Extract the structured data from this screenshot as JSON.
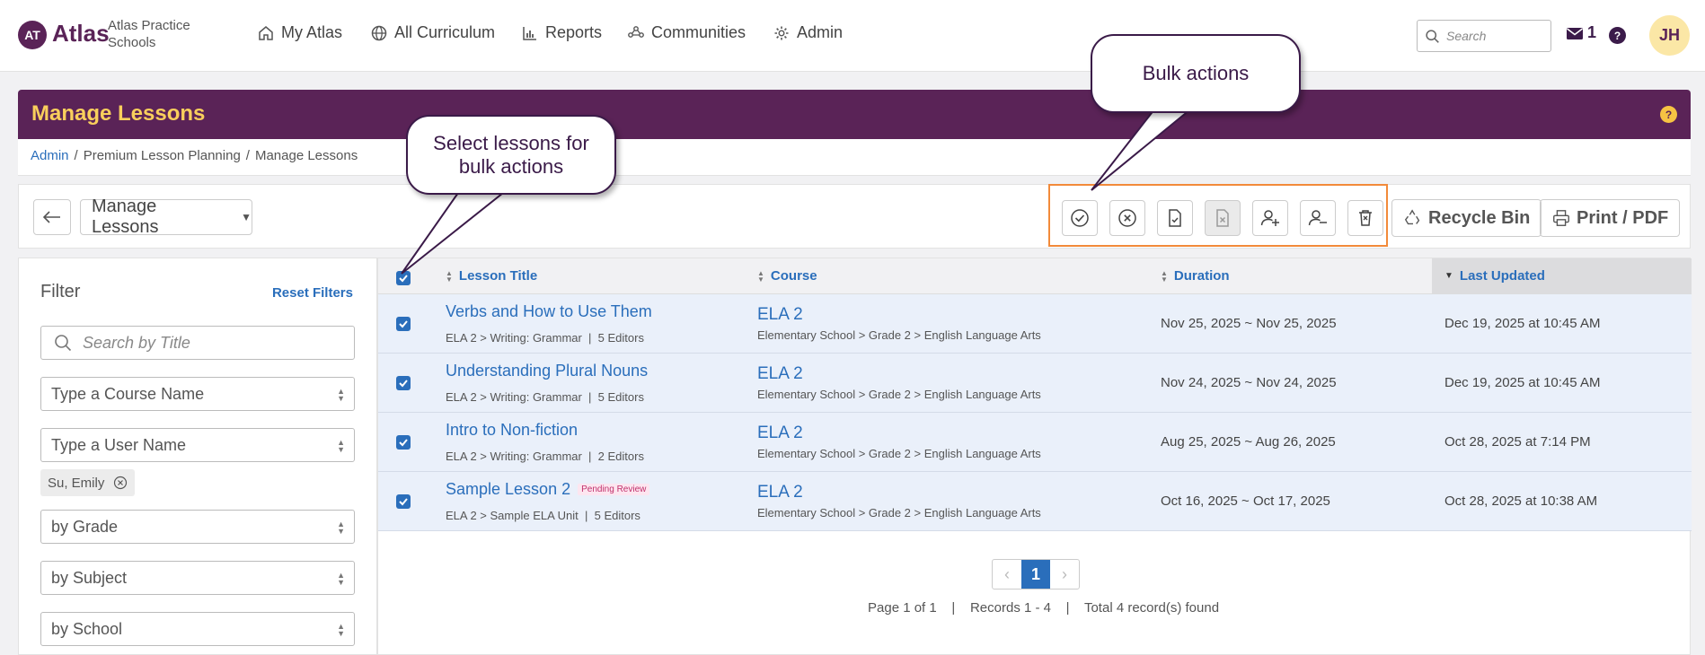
{
  "topnav": {
    "logo_initials": "AT",
    "logo_text": "Atlas",
    "school_name": "Atlas Practice Schools",
    "items": [
      {
        "label": "My Atlas",
        "icon": "home-icon"
      },
      {
        "label": "All Curriculum",
        "icon": "globe-icon"
      },
      {
        "label": "Reports",
        "icon": "bar-chart-icon"
      },
      {
        "label": "Communities",
        "icon": "network-icon"
      },
      {
        "label": "Admin",
        "icon": "gear-icon"
      }
    ],
    "search_placeholder": "Search",
    "mail_count": "1",
    "help": "?",
    "avatar_initials": "JH"
  },
  "banner": {
    "title": "Manage Lessons",
    "help": "?"
  },
  "breadcrumb": {
    "items": [
      "Admin",
      "Premium Lesson Planning",
      "Manage Lessons"
    ],
    "separator": "/"
  },
  "toolbar": {
    "view_select": "Manage Lessons",
    "bulk_actions": [
      {
        "name": "approve",
        "icon": "check-circle-icon"
      },
      {
        "name": "reject",
        "icon": "x-circle-icon"
      },
      {
        "name": "mark-complete",
        "icon": "doc-check-icon"
      },
      {
        "name": "mark-incomplete",
        "icon": "doc-x-icon",
        "disabled": true
      },
      {
        "name": "add-editor",
        "icon": "user-plus-icon"
      },
      {
        "name": "remove-editor",
        "icon": "user-minus-icon"
      },
      {
        "name": "delete",
        "icon": "trash-icon"
      }
    ],
    "recycle_bin": "Recycle Bin",
    "print_pdf": "Print / PDF"
  },
  "filter": {
    "title": "Filter",
    "reset": "Reset Filters",
    "search_placeholder": "Search by Title",
    "course_placeholder": "Type a Course Name",
    "user_placeholder": "Type a User Name",
    "selected_user": "Su, Emily",
    "grade": "by Grade",
    "subject": "by Subject",
    "school": "by School"
  },
  "table": {
    "headers": {
      "title": "Lesson Title",
      "course": "Course",
      "duration": "Duration",
      "updated": "Last Updated"
    },
    "rows": [
      {
        "title": "Verbs and How to Use Them",
        "badge": "",
        "sub": "ELA 2 > Writing: Grammar  |  5 Editors",
        "course": "ELA 2",
        "course_sub": "Elementary School > Grade 2 > English Language Arts",
        "duration": "Nov 25, 2025 ~ Nov 25, 2025",
        "updated": "Dec 19, 2025 at 10:45 AM"
      },
      {
        "title": "Understanding Plural Nouns",
        "badge": "",
        "sub": "ELA 2 > Writing: Grammar  |  5 Editors",
        "course": "ELA 2",
        "course_sub": "Elementary School > Grade 2 > English Language Arts",
        "duration": "Nov 24, 2025 ~ Nov 24, 2025",
        "updated": "Dec 19, 2025 at 10:45 AM"
      },
      {
        "title": "Intro to Non-fiction",
        "badge": "",
        "sub": "ELA 2 > Writing: Grammar  |  2 Editors",
        "course": "ELA 2",
        "course_sub": "Elementary School > Grade 2 > English Language Arts",
        "duration": "Aug 25, 2025 ~ Aug 26, 2025",
        "updated": "Oct 28, 2025 at 7:14 PM"
      },
      {
        "title": "Sample Lesson 2",
        "badge": "Pending Review",
        "sub": "ELA 2 > Sample ELA Unit  |  5 Editors",
        "course": "ELA 2",
        "course_sub": "Elementary School > Grade 2 > English Language Arts",
        "duration": "Oct 16, 2025 ~ Oct 17, 2025",
        "updated": "Oct 28, 2025 at 10:38 AM"
      }
    ]
  },
  "pagination": {
    "current": "1",
    "prev": "‹",
    "next": "›",
    "info": "Page 1 of 1    |    Records 1 - 4    |    Total 4 record(s) found"
  },
  "callouts": {
    "select": "Select lessons for bulk actions",
    "bulk": "Bulk actions"
  },
  "colors": {
    "brand": "#5a2357",
    "accent": "#f9cf5c",
    "link": "#2a6ebb",
    "highlight": "#f28a3a"
  }
}
